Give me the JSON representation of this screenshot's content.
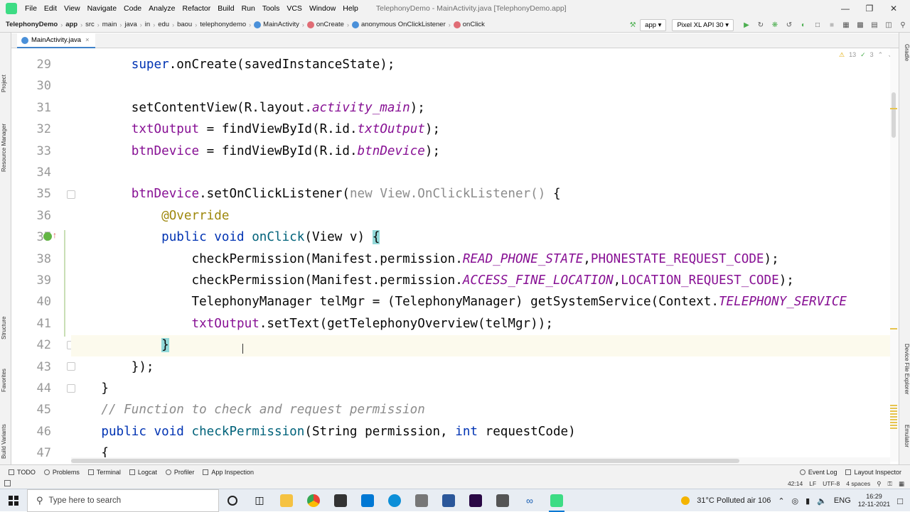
{
  "menubar": {
    "items": [
      "File",
      "Edit",
      "View",
      "Navigate",
      "Code",
      "Analyze",
      "Refactor",
      "Build",
      "Run",
      "Tools",
      "VCS",
      "Window",
      "Help"
    ],
    "window_title": "TelephonyDemo - MainActivity.java [TelephonyDemo.app]"
  },
  "breadcrumb": {
    "items": [
      "TelephonyDemo",
      "app",
      "src",
      "main",
      "java",
      "in",
      "edu",
      "baou",
      "telephonydemo",
      "MainActivity",
      "onCreate",
      "anonymous OnClickListener",
      "onClick"
    ]
  },
  "toolbar": {
    "run_config": "app",
    "device": "Pixel XL API 30"
  },
  "tab": {
    "label": "MainActivity.java"
  },
  "left_panels": [
    "Project",
    "Resource Manager",
    "Structure",
    "Favorites",
    "Build Variants"
  ],
  "right_panels": [
    "Gradle",
    "Device File Explorer",
    "Emulator"
  ],
  "inspections": {
    "warnings": "13",
    "checks": "3"
  },
  "editor": {
    "line_numbers": [
      "29",
      "30",
      "31",
      "32",
      "33",
      "34",
      "35",
      "36",
      "37",
      "38",
      "39",
      "40",
      "41",
      "42",
      "43",
      "44",
      "45",
      "46",
      "47"
    ],
    "lines": [
      {
        "indent": "        ",
        "tokens": [
          {
            "t": "super",
            "c": "kw"
          },
          {
            "t": ".onCreate(savedInstanceState);",
            "c": ""
          }
        ]
      },
      {
        "indent": "",
        "tokens": []
      },
      {
        "indent": "        ",
        "tokens": [
          {
            "t": "setContentView(R.layout.",
            "c": ""
          },
          {
            "t": "activity_main",
            "c": "sf"
          },
          {
            "t": ");",
            "c": ""
          }
        ]
      },
      {
        "indent": "        ",
        "tokens": [
          {
            "t": "txtOutput",
            "c": "fld"
          },
          {
            "t": " = findViewById(R.id.",
            "c": ""
          },
          {
            "t": "txtOutput",
            "c": "sf"
          },
          {
            "t": ");",
            "c": ""
          }
        ]
      },
      {
        "indent": "        ",
        "tokens": [
          {
            "t": "btnDevice",
            "c": "fld"
          },
          {
            "t": " = findViewById(R.id.",
            "c": ""
          },
          {
            "t": "btnDevice",
            "c": "sf"
          },
          {
            "t": ");",
            "c": ""
          }
        ]
      },
      {
        "indent": "",
        "tokens": []
      },
      {
        "indent": "        ",
        "tokens": [
          {
            "t": "btnDevice",
            "c": "fld"
          },
          {
            "t": ".setOnClickListener(",
            "c": ""
          },
          {
            "t": "new View.OnClickListener()",
            "c": "gray"
          },
          {
            "t": " {",
            "c": ""
          }
        ]
      },
      {
        "indent": "            ",
        "tokens": [
          {
            "t": "@Override",
            "c": "ann"
          }
        ]
      },
      {
        "indent": "            ",
        "tokens": [
          {
            "t": "public void ",
            "c": "kw"
          },
          {
            "t": "onClick",
            "c": "mth"
          },
          {
            "t": "(View v) ",
            "c": ""
          },
          {
            "t": "{",
            "c": "brace"
          }
        ]
      },
      {
        "indent": "                ",
        "tokens": [
          {
            "t": "checkPermission(Manifest.permission.",
            "c": ""
          },
          {
            "t": "READ_PHONE_STATE",
            "c": "sf"
          },
          {
            "t": ",",
            "c": ""
          },
          {
            "t": "PHONESTATE_REQUEST_CODE",
            "c": "fld"
          },
          {
            "t": ");",
            "c": ""
          }
        ]
      },
      {
        "indent": "                ",
        "tokens": [
          {
            "t": "checkPermission(Manifest.permission.",
            "c": ""
          },
          {
            "t": "ACCESS_FINE_LOCATION",
            "c": "sf"
          },
          {
            "t": ",",
            "c": ""
          },
          {
            "t": "LOCATION_REQUEST_CODE",
            "c": "fld"
          },
          {
            "t": ");",
            "c": ""
          }
        ]
      },
      {
        "indent": "                ",
        "tokens": [
          {
            "t": "TelephonyManager telMgr = (TelephonyManager) getSystemService(Context.",
            "c": ""
          },
          {
            "t": "TELEPHONY_SERVICE",
            "c": "sf"
          }
        ]
      },
      {
        "indent": "                ",
        "tokens": [
          {
            "t": "txtOutput",
            "c": "fld"
          },
          {
            "t": ".setText(getTelephonyOverview(telMgr));",
            "c": ""
          }
        ]
      },
      {
        "indent": "            ",
        "tokens": [
          {
            "t": "}",
            "c": "brace"
          }
        ]
      },
      {
        "indent": "        ",
        "tokens": [
          {
            "t": "});",
            "c": ""
          }
        ]
      },
      {
        "indent": "    ",
        "tokens": [
          {
            "t": "}",
            "c": ""
          }
        ]
      },
      {
        "indent": "    ",
        "tokens": [
          {
            "t": "// Function to check and request permission",
            "c": "cmt"
          }
        ]
      },
      {
        "indent": "    ",
        "tokens": [
          {
            "t": "public void ",
            "c": "kw"
          },
          {
            "t": "checkPermission",
            "c": "mth"
          },
          {
            "t": "(String permission, ",
            "c": ""
          },
          {
            "t": "int ",
            "c": "kw"
          },
          {
            "t": "requestCode)",
            "c": ""
          }
        ]
      },
      {
        "indent": "    ",
        "tokens": [
          {
            "t": "{",
            "c": ""
          }
        ]
      }
    ]
  },
  "toolwindows": {
    "left": [
      "TODO",
      "Problems",
      "Terminal",
      "Logcat",
      "Profiler",
      "App Inspection"
    ],
    "right": [
      "Event Log",
      "Layout Inspector"
    ]
  },
  "status": {
    "position": "42:14",
    "line_sep": "LF",
    "encoding": "UTF-8",
    "indent": "4 spaces"
  },
  "taskbar": {
    "search_placeholder": "Type here to search",
    "weather": "31°C  Polluted air 106",
    "lang": "ENG",
    "time": "16:29",
    "date": "12-11-2021"
  }
}
